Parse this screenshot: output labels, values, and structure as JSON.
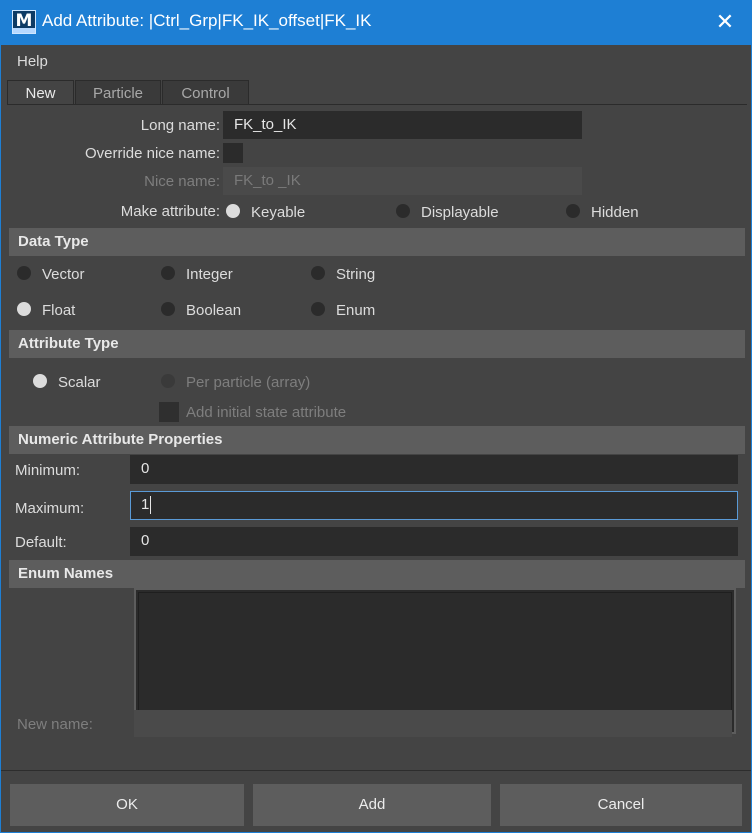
{
  "window": {
    "title": "Add Attribute: |Ctrl_Grp|FK_IK_offset|FK_IK",
    "icon": "maya-app-icon",
    "icon_letter": "M",
    "close_glyph": "✕",
    "accent_color": "#1e7fd4"
  },
  "menubar": {
    "help": "Help"
  },
  "tabs": [
    "New",
    "Particle",
    "Control"
  ],
  "form": {
    "long_name_label": "Long name:",
    "long_name_value": "FK_to_IK",
    "override_label": "Override nice name:",
    "nice_name_label": "Nice name:",
    "nice_name_value": "FK_to _IK",
    "make_attr_label": "Make attribute:",
    "make_options": [
      "Keyable",
      "Displayable",
      "Hidden"
    ]
  },
  "data_type": {
    "header": "Data Type",
    "options": [
      "Vector",
      "Integer",
      "String",
      "Float",
      "Boolean",
      "Enum"
    ],
    "selected": "Float"
  },
  "attribute_type": {
    "header": "Attribute Type",
    "scalar": "Scalar",
    "per_particle": "Per particle (array)",
    "initial_state": "Add initial state attribute"
  },
  "numeric": {
    "header": "Numeric Attribute Properties",
    "min_label": "Minimum:",
    "min_value": "0",
    "max_label": "Maximum:",
    "max_value": "1",
    "default_label": "Default:",
    "default_value": "0"
  },
  "enum": {
    "header": "Enum Names",
    "new_name_label": "New name:"
  },
  "buttons": {
    "ok": "OK",
    "add": "Add",
    "cancel": "Cancel"
  }
}
